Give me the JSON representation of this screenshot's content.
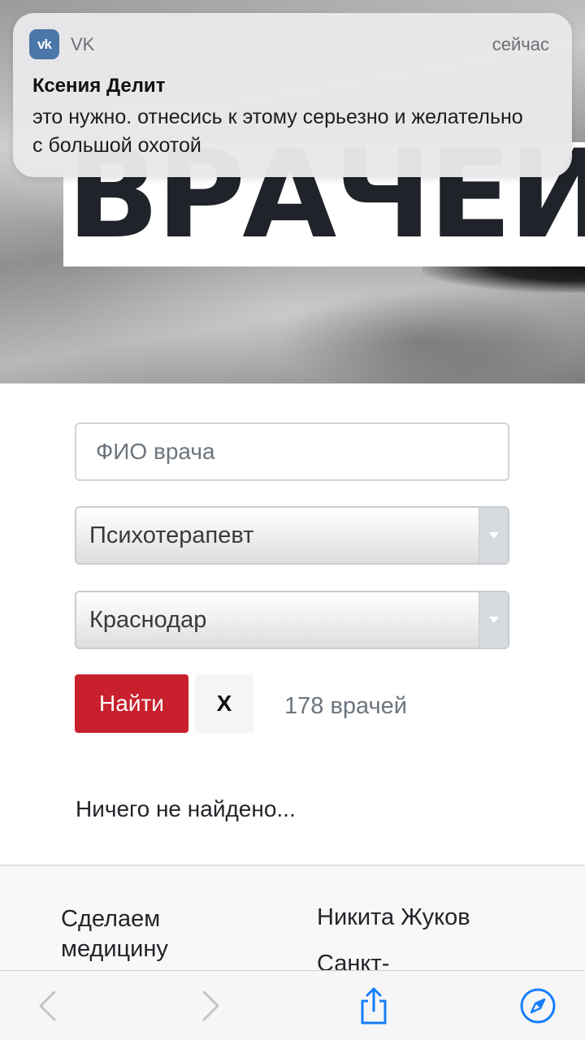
{
  "hero": {
    "banner_text": "ВРАЧЕЙ"
  },
  "notification": {
    "app_icon": "vk-logo-icon",
    "app_icon_text": "vk",
    "app_name": "VK",
    "time": "сейчас",
    "sender": "Ксения Делит",
    "message": "это нужно. отнесись к этому серьезно и желательно с большой охотой",
    "icon_color": "#4a76a8"
  },
  "search_form": {
    "name_placeholder": "ФИО врача",
    "name_value": "",
    "specialty_selected": "Психотерапевт",
    "city_selected": "Краснодар",
    "find_label": "Найти",
    "clear_label": "X",
    "result_count": "178 врачей",
    "empty_message": "Ничего не найдено...",
    "accent_color": "#c8202d"
  },
  "footer": {
    "left_text": "Сделаем медицину",
    "right_title": "Никита Жуков",
    "right_subtitle": "Санкт-"
  },
  "browser_toolbar": {
    "back_icon": "chevron-left-icon",
    "forward_icon": "chevron-right-icon",
    "share_icon": "share-icon",
    "compass_icon": "compass-icon",
    "active_color": "#157efb",
    "disabled_color": "#c4c4c6"
  }
}
